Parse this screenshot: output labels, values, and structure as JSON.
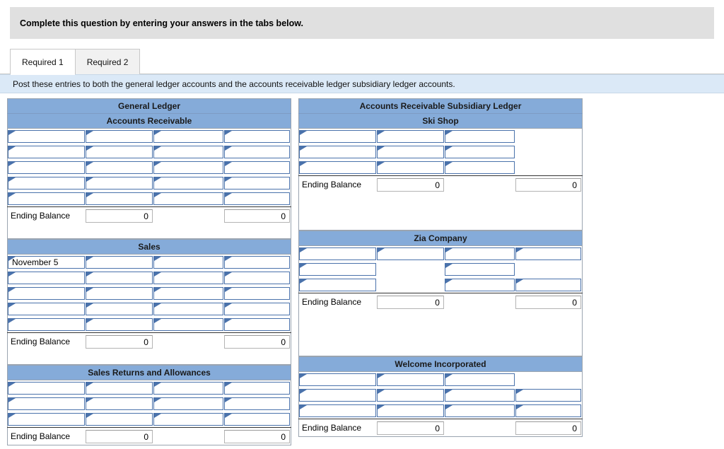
{
  "banner": {
    "text": "Complete this question by entering your answers in the tabs below."
  },
  "tabs": [
    {
      "label": "Required 1",
      "active": true
    },
    {
      "label": "Required 2",
      "active": false
    }
  ],
  "instruction": {
    "text": "Post these entries to both the general ledger accounts and the accounts receivable ledger subsidiary ledger accounts."
  },
  "labels": {
    "ending_balance": "Ending Balance",
    "zero": "0"
  },
  "colors": {
    "header_blue": "#85abd9",
    "instruction_blue": "#dbe9f7",
    "banner_gray": "#e0e0e0",
    "input_border": "#4a72ab"
  },
  "left_ledger": {
    "title": "General Ledger",
    "accounts": [
      {
        "name": "Accounts Receivable",
        "rows": [
          {
            "cells": [
              {
                "type": "input",
                "value": ""
              },
              {
                "type": "input",
                "value": ""
              },
              {
                "type": "input",
                "value": ""
              },
              {
                "type": "input",
                "value": ""
              }
            ]
          },
          {
            "cells": [
              {
                "type": "input",
                "value": ""
              },
              {
                "type": "input",
                "value": ""
              },
              {
                "type": "input",
                "value": ""
              },
              {
                "type": "input",
                "value": ""
              }
            ]
          },
          {
            "cells": [
              {
                "type": "input",
                "value": ""
              },
              {
                "type": "input",
                "value": ""
              },
              {
                "type": "input",
                "value": ""
              },
              {
                "type": "input",
                "value": ""
              }
            ]
          },
          {
            "cells": [
              {
                "type": "input",
                "value": ""
              },
              {
                "type": "input",
                "value": ""
              },
              {
                "type": "input",
                "value": ""
              },
              {
                "type": "input",
                "value": ""
              }
            ]
          },
          {
            "cells": [
              {
                "type": "input",
                "value": ""
              },
              {
                "type": "input",
                "value": ""
              },
              {
                "type": "input",
                "value": ""
              },
              {
                "type": "input",
                "value": ""
              }
            ]
          }
        ],
        "ending": {
          "label": "Ending Balance",
          "debit": "0",
          "credit": "0"
        },
        "spacer": "normal"
      },
      {
        "name": "Sales",
        "rows": [
          {
            "cells": [
              {
                "type": "input",
                "value": "November 5"
              },
              {
                "type": "input",
                "value": ""
              },
              {
                "type": "input",
                "value": ""
              },
              {
                "type": "input",
                "value": ""
              }
            ]
          },
          {
            "cells": [
              {
                "type": "input",
                "value": ""
              },
              {
                "type": "input",
                "value": ""
              },
              {
                "type": "input",
                "value": ""
              },
              {
                "type": "input",
                "value": ""
              }
            ]
          },
          {
            "cells": [
              {
                "type": "input",
                "value": ""
              },
              {
                "type": "input",
                "value": ""
              },
              {
                "type": "input",
                "value": ""
              },
              {
                "type": "input",
                "value": ""
              }
            ]
          },
          {
            "cells": [
              {
                "type": "input",
                "value": ""
              },
              {
                "type": "input",
                "value": ""
              },
              {
                "type": "input",
                "value": ""
              },
              {
                "type": "input",
                "value": ""
              }
            ]
          },
          {
            "cells": [
              {
                "type": "input",
                "value": ""
              },
              {
                "type": "input",
                "value": ""
              },
              {
                "type": "input",
                "value": ""
              },
              {
                "type": "input",
                "value": ""
              }
            ]
          }
        ],
        "ending": {
          "label": "Ending Balance",
          "debit": "0",
          "credit": "0"
        },
        "spacer": "normal"
      },
      {
        "name": "Sales Returns and Allowances",
        "rows": [
          {
            "cells": [
              {
                "type": "input",
                "value": ""
              },
              {
                "type": "input",
                "value": ""
              },
              {
                "type": "input",
                "value": ""
              },
              {
                "type": "input",
                "value": ""
              }
            ]
          },
          {
            "cells": [
              {
                "type": "input",
                "value": ""
              },
              {
                "type": "input",
                "value": ""
              },
              {
                "type": "input",
                "value": ""
              },
              {
                "type": "input",
                "value": ""
              }
            ]
          },
          {
            "cells": [
              {
                "type": "input",
                "value": ""
              },
              {
                "type": "input",
                "value": ""
              },
              {
                "type": "input",
                "value": ""
              },
              {
                "type": "input",
                "value": ""
              }
            ]
          }
        ],
        "ending": {
          "label": "Ending Balance",
          "debit": "0",
          "credit": "0"
        },
        "spacer": "none"
      }
    ]
  },
  "right_ledger": {
    "title": "Accounts Receivable Subsidiary Ledger",
    "accounts": [
      {
        "name": "Ski Shop",
        "rows": [
          {
            "cells": [
              {
                "type": "input",
                "value": ""
              },
              {
                "type": "input",
                "value": ""
              },
              {
                "type": "input",
                "value": ""
              },
              {
                "type": "plain",
                "value": ""
              }
            ]
          },
          {
            "cells": [
              {
                "type": "input",
                "value": ""
              },
              {
                "type": "input",
                "value": ""
              },
              {
                "type": "input",
                "value": ""
              },
              {
                "type": "plain",
                "value": ""
              }
            ]
          },
          {
            "cells": [
              {
                "type": "input",
                "value": ""
              },
              {
                "type": "input",
                "value": ""
              },
              {
                "type": "input",
                "value": ""
              },
              {
                "type": "plain",
                "value": ""
              }
            ]
          }
        ],
        "ending": {
          "label": "Ending Balance",
          "debit": "0",
          "credit": "0"
        },
        "spacer": "tall"
      },
      {
        "name": "Zia Company",
        "rows": [
          {
            "cells": [
              {
                "type": "input",
                "value": ""
              },
              {
                "type": "input",
                "value": ""
              },
              {
                "type": "input",
                "value": ""
              },
              {
                "type": "input",
                "value": ""
              }
            ]
          },
          {
            "cells": [
              {
                "type": "input",
                "value": ""
              },
              {
                "type": "plain",
                "value": ""
              },
              {
                "type": "input",
                "value": ""
              },
              {
                "type": "plain",
                "value": ""
              }
            ]
          },
          {
            "cells": [
              {
                "type": "input",
                "value": ""
              },
              {
                "type": "plain",
                "value": ""
              },
              {
                "type": "input",
                "value": ""
              },
              {
                "type": "input",
                "value": ""
              }
            ]
          }
        ],
        "ending": {
          "label": "Ending Balance",
          "debit": "0",
          "credit": "0"
        },
        "spacer": "xtall"
      },
      {
        "name": "Welcome Incorporated",
        "rows": [
          {
            "cells": [
              {
                "type": "input",
                "value": ""
              },
              {
                "type": "input",
                "value": ""
              },
              {
                "type": "input",
                "value": ""
              },
              {
                "type": "plain",
                "value": ""
              }
            ]
          },
          {
            "cells": [
              {
                "type": "input",
                "value": ""
              },
              {
                "type": "input",
                "value": ""
              },
              {
                "type": "input",
                "value": ""
              },
              {
                "type": "input",
                "value": ""
              }
            ]
          },
          {
            "cells": [
              {
                "type": "input",
                "value": ""
              },
              {
                "type": "input",
                "value": ""
              },
              {
                "type": "input",
                "value": ""
              },
              {
                "type": "input",
                "value": ""
              }
            ]
          }
        ],
        "ending": {
          "label": "Ending Balance",
          "debit": "0",
          "credit": "0"
        },
        "spacer": "none"
      }
    ]
  }
}
